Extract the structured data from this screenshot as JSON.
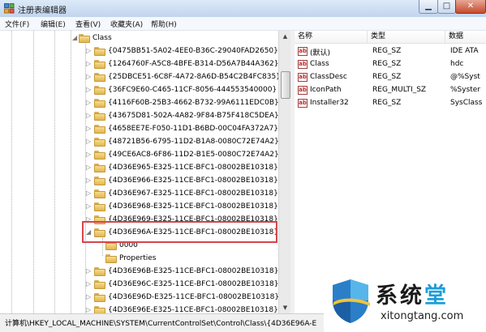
{
  "window": {
    "title": "注册表编辑器"
  },
  "menu": [
    "文件(F)",
    "编辑(E)",
    "查看(V)",
    "收藏夹(A)",
    "帮助(H)"
  ],
  "tree": [
    {
      "label": "Class",
      "depth": 0,
      "expanded": true
    },
    {
      "label": "{0475BB51-5A02-4EE0-B36C-29040FAD2650}",
      "depth": 1
    },
    {
      "label": "{1264760F-A5C8-4BFE-B314-D56A7B44A362}",
      "depth": 1
    },
    {
      "label": "{25DBCE51-6C8F-4A72-8A6D-B54C2B4FC835}",
      "depth": 1
    },
    {
      "label": "{36FC9E60-C465-11CF-8056-444553540000}",
      "depth": 1
    },
    {
      "label": "{4116F60B-25B3-4662-B732-99A6111EDC0B}",
      "depth": 1
    },
    {
      "label": "{43675D81-502A-4A82-9F84-B75F418C5DEA}",
      "depth": 1
    },
    {
      "label": "{4658EE7E-F050-11D1-B6BD-00C04FA372A7}",
      "depth": 1
    },
    {
      "label": "{48721B56-6795-11D2-B1A8-0080C72E74A2}",
      "depth": 1
    },
    {
      "label": "{49CE6AC8-6F86-11D2-B1E5-0080C72E74A2}",
      "depth": 1
    },
    {
      "label": "{4D36E965-E325-11CE-BFC1-08002BE10318}",
      "depth": 1
    },
    {
      "label": "{4D36E966-E325-11CE-BFC1-08002BE10318}",
      "depth": 1
    },
    {
      "label": "{4D36E967-E325-11CE-BFC1-08002BE10318}",
      "depth": 1
    },
    {
      "label": "{4D36E968-E325-11CE-BFC1-08002BE10318}",
      "depth": 1
    },
    {
      "label": "{4D36E969-E325-11CE-BFC1-08002BE10318}",
      "depth": 1
    },
    {
      "label": "{4D36E96A-E325-11CE-BFC1-08002BE10318}",
      "depth": 1,
      "expanded": true
    },
    {
      "label": "0000",
      "depth": 2,
      "leaf": true
    },
    {
      "label": "Properties",
      "depth": 2,
      "leaf": true
    },
    {
      "label": "{4D36E96B-E325-11CE-BFC1-08002BE10318}",
      "depth": 1
    },
    {
      "label": "{4D36E96C-E325-11CE-BFC1-08002BE10318}",
      "depth": 1
    },
    {
      "label": "{4D36E96D-E325-11CE-BFC1-08002BE10318}",
      "depth": 1
    },
    {
      "label": "{4D36E96E-E325-11CE-BFC1-08002BE10318}",
      "depth": 1
    }
  ],
  "values_pane": {
    "columns": [
      "名称",
      "类型",
      "数据"
    ],
    "rows": [
      {
        "name": "(默认)",
        "type": "REG_SZ",
        "data": "IDE ATA"
      },
      {
        "name": "Class",
        "type": "REG_SZ",
        "data": "hdc"
      },
      {
        "name": "ClassDesc",
        "type": "REG_SZ",
        "data": "@%Syst"
      },
      {
        "name": "IconPath",
        "type": "REG_MULTI_SZ",
        "data": "%Syster"
      },
      {
        "name": "Installer32",
        "type": "REG_SZ",
        "data": "SysClass"
      }
    ],
    "icon_text": "ab"
  },
  "status": {
    "path": "计算机\\HKEY_LOCAL_MACHINE\\SYSTEM\\CurrentControlSet\\Control\\Class\\{4D36E96A-E"
  },
  "watermark": {
    "name_main": "系统",
    "name_accent": "堂",
    "url": "xitongtang.com"
  },
  "colors": {
    "highlight_box": "#d5464b",
    "folder": "#e8c060",
    "watermark_accent": "#1e9ed8"
  }
}
